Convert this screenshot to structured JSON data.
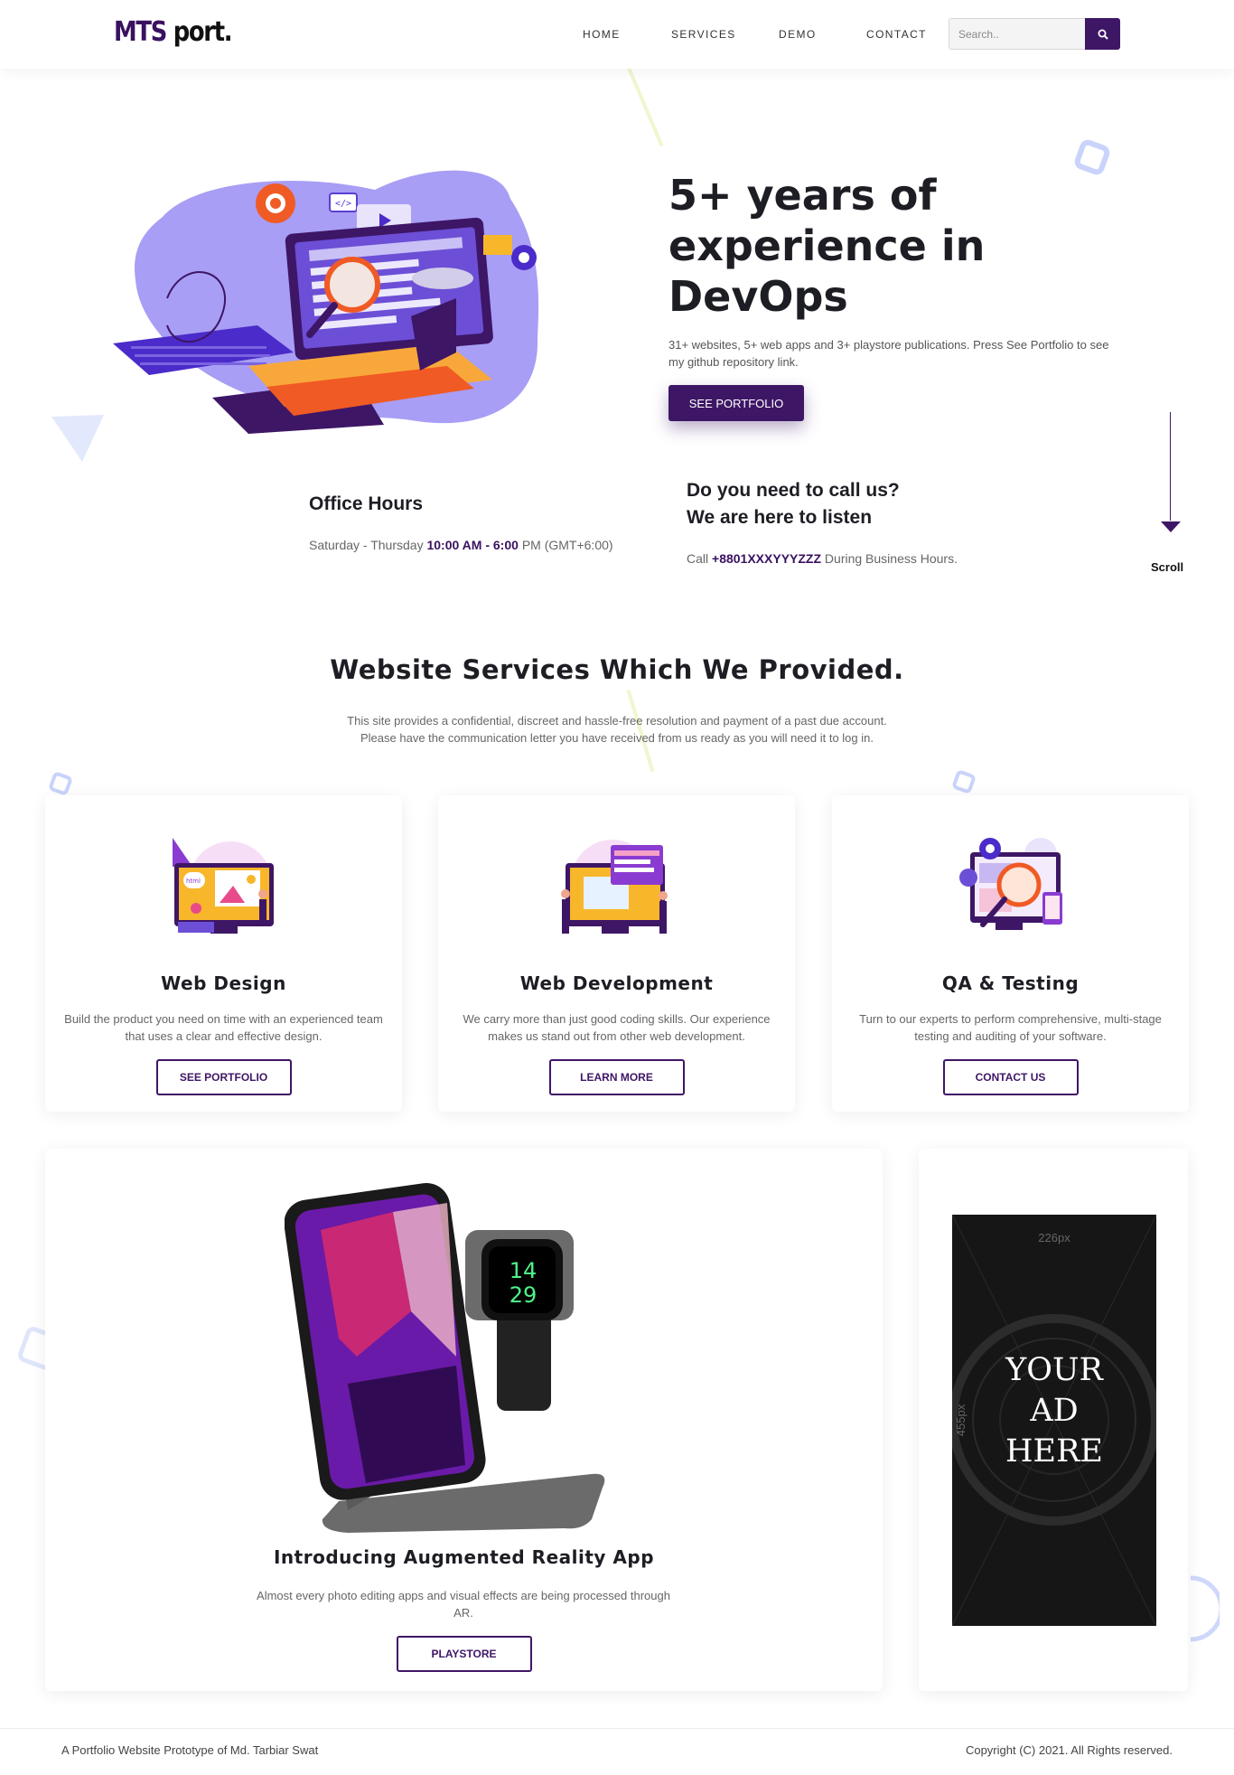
{
  "header": {
    "logo_primary": "MTS",
    "logo_secondary": "port.",
    "nav": [
      "HOME",
      "SERVICES",
      "DEMO",
      "CONTACT"
    ],
    "search_placeholder": "Search..",
    "search_icon": "search-icon"
  },
  "hero": {
    "title": "5+ years of experience in DevOps",
    "description": "31+ websites, 5+ web apps and 3+ playstore publications. Press See Portfolio to see my github repository link.",
    "button": "SEE PORTFOLIO"
  },
  "office": {
    "title": "Office Hours",
    "days": "Saturday - Thursday",
    "time_open": "10:00 AM",
    "time_sep": " - ",
    "time_close": "6:00",
    "time_suffix": "PM (GMT+6:00)"
  },
  "call": {
    "title_line1": "Do you need to call us?",
    "title_line2": "We are here to listen",
    "prefix": "Call",
    "phone": "+8801XXXYYYZZZ",
    "suffix": "During Business Hours."
  },
  "scroll": {
    "label": "Scroll"
  },
  "services": {
    "title": "Website Services Which We Provided.",
    "description_line1": "This site provides a confidential, discreet and hassle-free resolution and payment of a past due account.",
    "description_line2": "Please have the communication letter you have received from us ready as you will need it to log in.",
    "cards": [
      {
        "title": "Web Design",
        "text": "Build the product you need on time with an experienced team that uses a clear and effective design.",
        "button": "SEE PORTFOLIO"
      },
      {
        "title": "Web Development",
        "text": "We carry more than just good coding skills. Our experience makes us stand out from other web development.",
        "button": "LEARN MORE"
      },
      {
        "title": "QA & Testing",
        "text": "Turn to our experts to perform comprehensive, multi-stage testing and auditing of your software.",
        "button": "CONTACT US"
      }
    ]
  },
  "ar": {
    "title": "Introducing Augmented Reality App",
    "text": "Almost every photo editing apps and visual effects are being processed through AR.",
    "button": "PLAYSTORE",
    "watch_time_top": "14",
    "watch_time_bottom": "29"
  },
  "ad": {
    "width_label": "226px",
    "height_label": "455px",
    "line1": "YOUR",
    "line2": "AD",
    "line3": "HERE"
  },
  "footer": {
    "left": "A Portfolio Website Prototype of Md. Tarbiar Swat",
    "right": "Copyright (C) 2021. All Rights reserved."
  },
  "colors": {
    "brand": "#3e1666",
    "accent_purple": "#a89ef5",
    "text_dark": "#1d1d24"
  }
}
